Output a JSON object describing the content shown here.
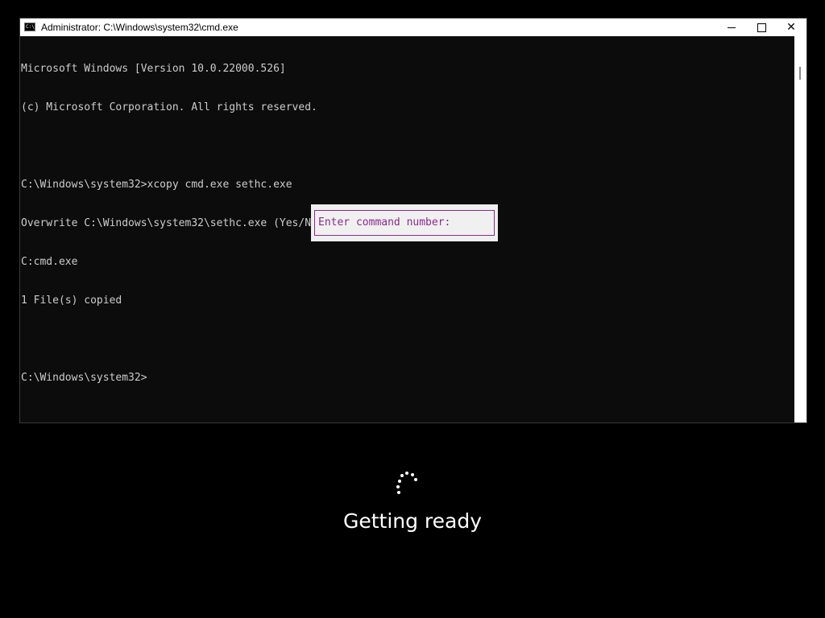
{
  "window": {
    "title": "Administrator: C:\\Windows\\system32\\cmd.exe",
    "icon_text": "C:\\",
    "controls": {
      "minimize": "minimize-icon",
      "maximize": "maximize-icon",
      "close": "✕"
    }
  },
  "console": {
    "lines": [
      "Microsoft Windows [Version 10.0.22000.526]",
      "(c) Microsoft Corporation. All rights reserved.",
      "",
      "C:\\Windows\\system32>xcopy cmd.exe sethc.exe",
      "Overwrite C:\\Windows\\system32\\sethc.exe (Yes/No/All)? y",
      "C:cmd.exe",
      "1 File(s) copied",
      "",
      "C:\\Windows\\system32>"
    ]
  },
  "prompt": {
    "text": "Enter command number:"
  },
  "status": {
    "text": "Getting ready"
  },
  "colors": {
    "console_bg": "#0c0c0c",
    "console_text": "#cccccc",
    "prompt_accent": "#8b2a8b",
    "screen_bg": "#000000"
  }
}
